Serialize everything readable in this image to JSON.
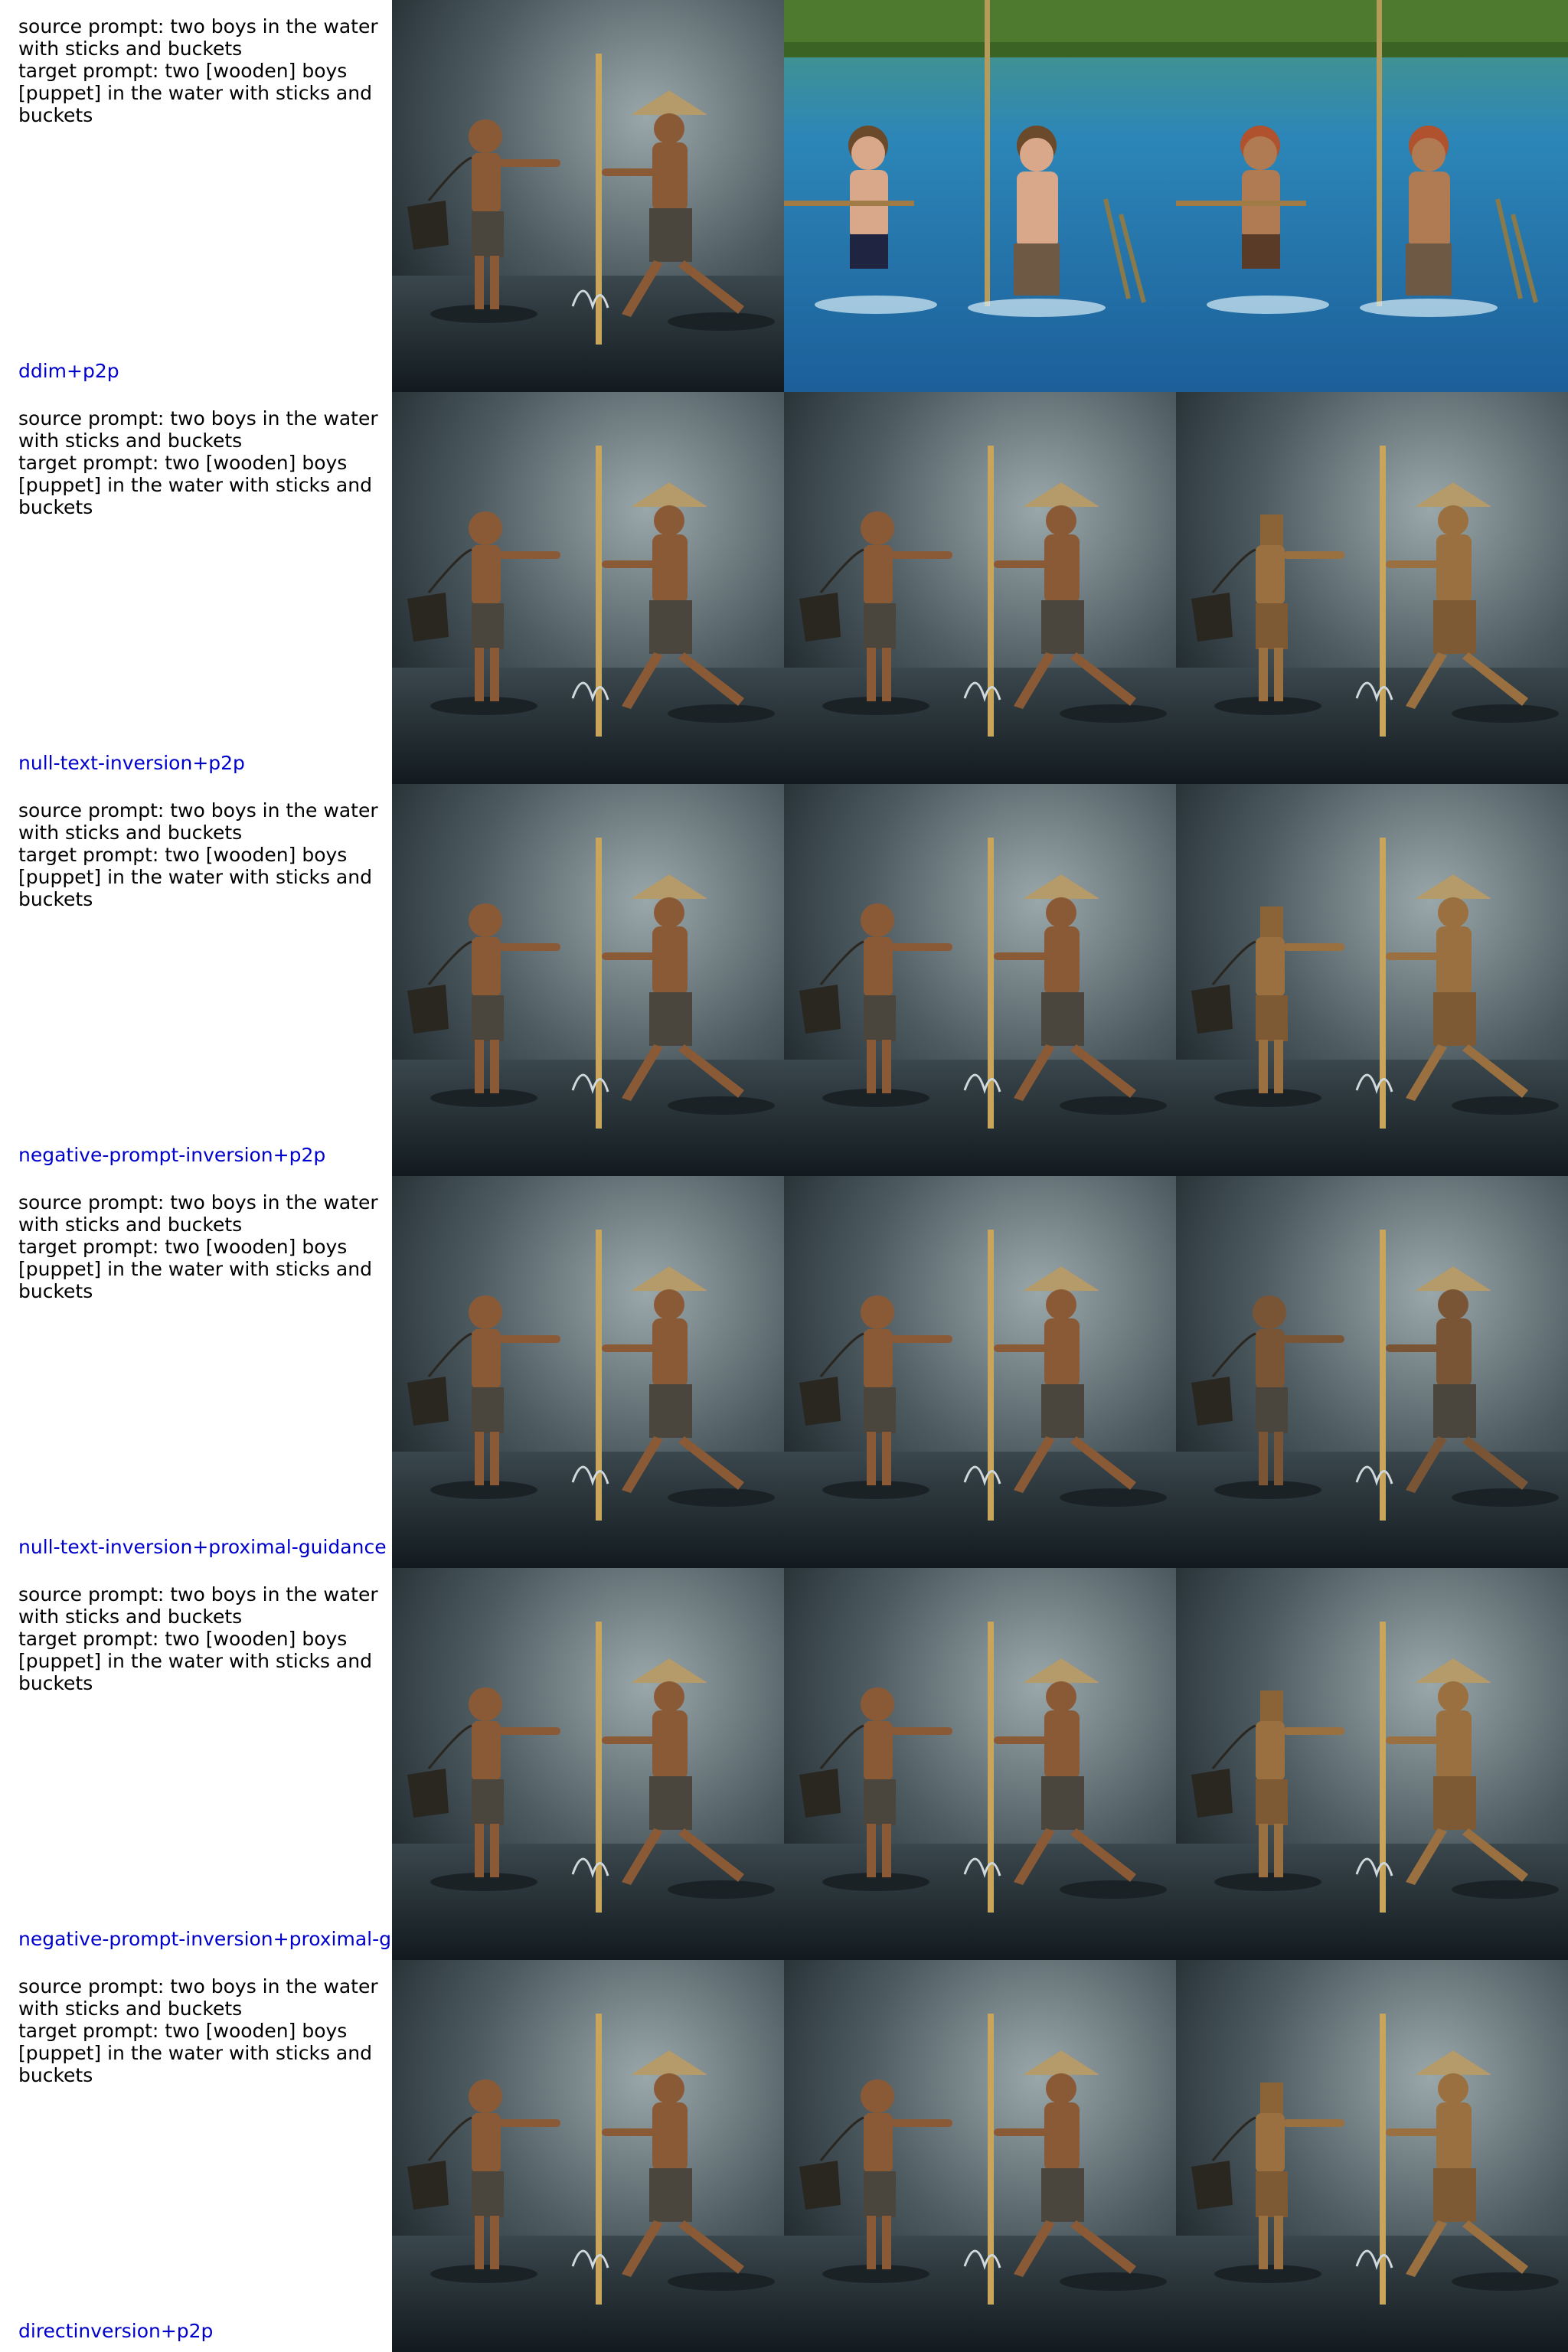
{
  "rows": [
    {
      "source_prompt": "source prompt: two boys in the water\nwith sticks and buckets",
      "target_prompt": "target prompt: two [wooden] boys\n[puppet] in the water with sticks and\nbuckets",
      "method": "ddim+p2p",
      "cells": [
        "source-photo-scene",
        "blue-water-reconstruction",
        "wooden-puppet-edit"
      ]
    },
    {
      "source_prompt": "source prompt: two boys in the water\nwith sticks and buckets",
      "target_prompt": "target prompt: two [wooden] boys\n[puppet] in the water with sticks and\nbuckets",
      "method": "null-text-inversion+p2p",
      "cells": [
        "source-photo-scene",
        "reconstruction-scene",
        "wooden-puppet-edit"
      ]
    },
    {
      "source_prompt": "source prompt: two boys in the water\nwith sticks and buckets",
      "target_prompt": "target prompt: two [wooden] boys\n[puppet] in the water with sticks and\nbuckets",
      "method": "negative-prompt-inversion+p2p",
      "cells": [
        "source-photo-scene",
        "reconstruction-scene",
        "wooden-puppet-edit"
      ]
    },
    {
      "source_prompt": "source prompt: two boys in the water\nwith sticks and buckets",
      "target_prompt": "target prompt: two [wooden] boys\n[puppet] in the water with sticks and\nbuckets",
      "method": "null-text-inversion+proximal-guidance",
      "cells": [
        "source-photo-scene",
        "reconstruction-scene",
        "partial-edit-scene"
      ]
    },
    {
      "source_prompt": "source prompt: two boys in the water\nwith sticks and buckets",
      "target_prompt": "target prompt: two [wooden] boys\n[puppet] in the water with sticks and\nbuckets",
      "method": "negative-prompt-inversion+proximal-g",
      "cells": [
        "source-photo-scene",
        "reconstruction-scene",
        "wooden-puppet-edit"
      ]
    },
    {
      "source_prompt": "source prompt: two boys in the water\nwith sticks and buckets",
      "target_prompt": "target prompt: two [wooden] boys\n[puppet] in the water with sticks and\nbuckets",
      "method": "directinversion+p2p",
      "cells": [
        "source-photo-scene",
        "reconstruction-scene",
        "wooden-puppet-edit"
      ]
    }
  ],
  "colors": {
    "label_text": "#000000",
    "method_text": "#0000cc",
    "photo_bg_dark": "#1f2a30",
    "photo_bg_light": "#8a979a",
    "skin": "#8a5a36",
    "wood": "#9a7040",
    "water_blue": "#2c86b8",
    "foliage": "#4e7a30"
  }
}
